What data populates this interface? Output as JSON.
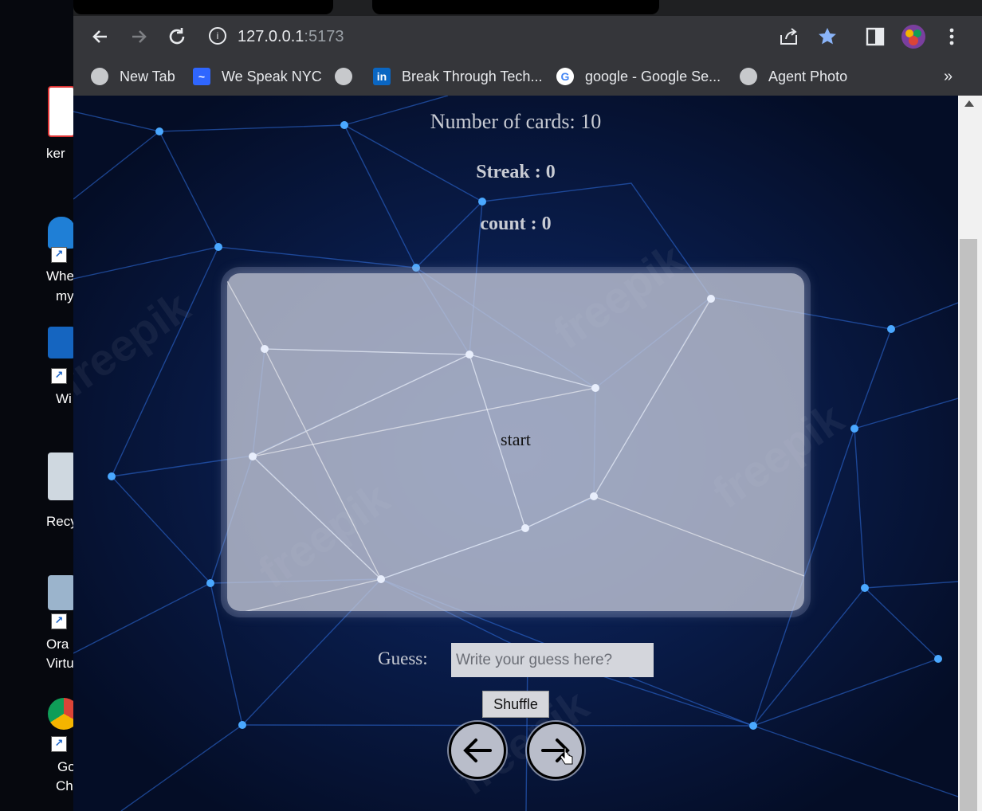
{
  "desktop": {
    "labels": [
      "ker",
      "Whe",
      "my",
      "Wi",
      "Recy",
      "Ora",
      "Virtu",
      "Go",
      "Chr"
    ]
  },
  "browser": {
    "url": "127.0.0.1",
    "port": ":5173",
    "bookmarks": [
      {
        "label": "New Tab",
        "icon": "globe-icon"
      },
      {
        "label": "We Speak NYC",
        "icon": "wespeaknyc-icon"
      },
      {
        "label": "",
        "icon": "globe-icon"
      },
      {
        "label": "Break Through Tech...",
        "icon": "linkedin-icon"
      },
      {
        "label": "google - Google Se...",
        "icon": "google-icon"
      },
      {
        "label": "Agent Photo",
        "icon": "globe-icon"
      }
    ],
    "more_bookmarks": "»"
  },
  "app": {
    "num_cards_label": "Number of cards: 10",
    "streak_label": "Streak : 0",
    "count_label": "count : 0",
    "card_text": "start",
    "guess_label": "Guess:",
    "guess_placeholder": "Write your guess here?",
    "guess_value": "",
    "shuffle_label": "Shuffle",
    "watermark": "freepik"
  },
  "colors": {
    "page_bg": "#071636",
    "card_bg": "#c6cbda",
    "text_light": "#c9ccd4",
    "toolbar": "#35363a",
    "star": "#8ab4f8"
  }
}
